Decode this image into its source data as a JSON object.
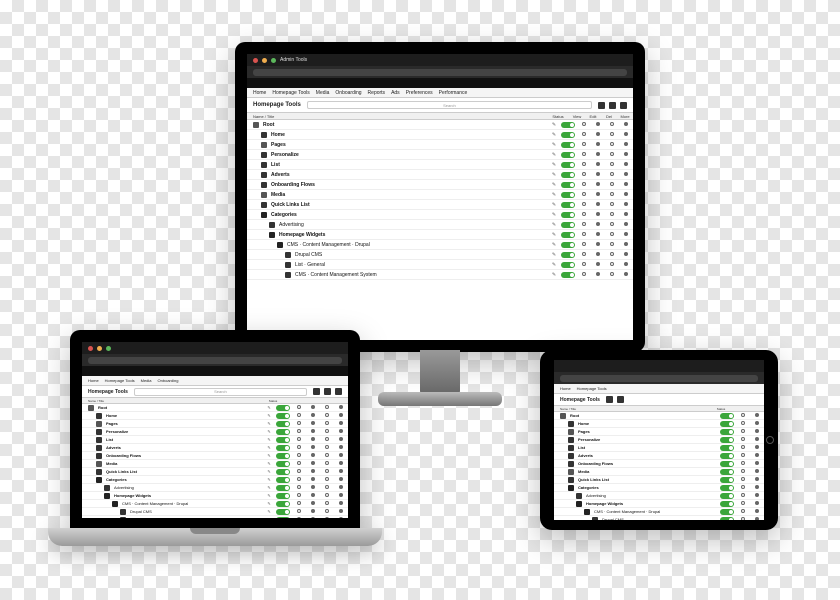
{
  "browser": {
    "tab_title": "Admin Tools",
    "url": "app/admin/homepage-tools"
  },
  "menubar": [
    "Home",
    "Homepage Tools",
    "Media",
    "Onboarding",
    "Reports",
    "Ads",
    "Preferences",
    "Performance"
  ],
  "page": {
    "title": "Homepage Tools",
    "search_placeholder": "Search"
  },
  "columns": {
    "name": "Name / Title",
    "edit": "",
    "status": "Status",
    "c1": "View",
    "c2": "Edit",
    "c3": "Del",
    "c4": "More"
  },
  "rows": [
    {
      "indent": 0,
      "icon": "folder",
      "label": "Root",
      "bold": true,
      "on": true
    },
    {
      "indent": 1,
      "icon": "item",
      "label": "Home",
      "bold": true,
      "on": true
    },
    {
      "indent": 1,
      "icon": "folder",
      "label": "Pages",
      "bold": true,
      "on": true
    },
    {
      "indent": 1,
      "icon": "item",
      "label": "Personalize",
      "bold": true,
      "on": true
    },
    {
      "indent": 1,
      "icon": "item",
      "label": "List",
      "bold": true,
      "on": true
    },
    {
      "indent": 1,
      "icon": "item",
      "label": "Adverts",
      "bold": true,
      "on": true
    },
    {
      "indent": 1,
      "icon": "item",
      "label": "Onboarding Flows",
      "bold": true,
      "on": true
    },
    {
      "indent": 1,
      "icon": "folder",
      "label": "Media",
      "bold": true,
      "on": true
    },
    {
      "indent": 1,
      "icon": "item",
      "label": "Quick Links List",
      "bold": true,
      "on": true
    },
    {
      "indent": 1,
      "icon": "folder-open",
      "label": "Categories",
      "bold": true,
      "on": true
    },
    {
      "indent": 2,
      "icon": "item",
      "label": "Advertising",
      "bold": false,
      "on": true
    },
    {
      "indent": 2,
      "icon": "folder-open",
      "label": "Homepage Widgets",
      "bold": true,
      "on": true
    },
    {
      "indent": 3,
      "icon": "folder-open",
      "label": "CMS · Content Management · Drupal",
      "bold": false,
      "on": true
    },
    {
      "indent": 4,
      "icon": "item",
      "label": "Drupal CMS",
      "bold": false,
      "on": true
    },
    {
      "indent": 4,
      "icon": "item",
      "label": "List · General",
      "bold": false,
      "on": true
    },
    {
      "indent": 4,
      "icon": "item",
      "label": "CMS · Content Management System",
      "bold": false,
      "on": true
    }
  ],
  "colors": {
    "accent_green": "#3aa63a"
  }
}
